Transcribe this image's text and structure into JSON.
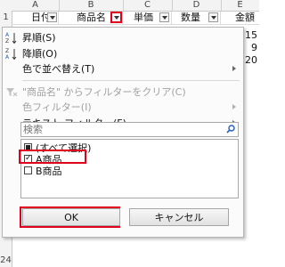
{
  "sheet": {
    "row_number_top": "1",
    "row_number_bottom": "24",
    "columns": [
      "A",
      "B",
      "C",
      "D",
      "E"
    ],
    "headers": [
      "日付",
      "商品名",
      "単価",
      "数量",
      "金額"
    ],
    "values_e": [
      "15",
      "9",
      "20"
    ]
  },
  "menu": {
    "sort_asc": "昇順(S)",
    "sort_desc": "降順(O)",
    "sort_color": "色で並べ替え(T)",
    "clear_filter": "\"商品名\" からフィルターをクリア(C)",
    "color_filter": "色フィルター(I)",
    "text_filter": "テキスト フィルター(F)"
  },
  "search": {
    "placeholder": "検索"
  },
  "list": {
    "items": [
      "(すべて選択)",
      "A商品",
      "B商品"
    ],
    "states": [
      "partial",
      "checked",
      "unchecked"
    ]
  },
  "buttons": {
    "ok": "OK",
    "cancel": "キャンセル"
  },
  "colors": {
    "highlight": "#e0001b"
  }
}
